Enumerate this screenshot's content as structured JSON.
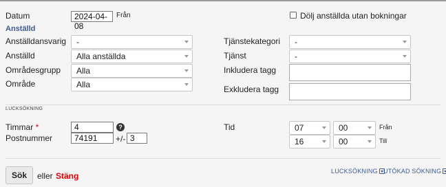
{
  "form": {
    "date_label": "Datum",
    "date_value": "2024-04-08",
    "date_suffix": "Från",
    "hide_checkbox_label": "Dölj anställda utan bokningar",
    "hide_checkbox_checked": false,
    "section_title": "Anställd",
    "fields": {
      "responsible": {
        "label": "Anställdansvarig",
        "value": "-"
      },
      "employee": {
        "label": "Anställd",
        "value": "Alla anställda"
      },
      "area_group": {
        "label": "Områdesgrupp",
        "value": "Alla"
      },
      "area": {
        "label": "Område",
        "value": "Alla"
      },
      "service_category": {
        "label": "Tjänstekategori",
        "value": "-"
      },
      "service": {
        "label": "Tjänst",
        "value": "-"
      },
      "include_tags": {
        "label": "Inkludera tagg",
        "value": ""
      },
      "exclude_tags": {
        "label": "Exkludera tagg",
        "value": ""
      }
    }
  },
  "gap_search": {
    "section_title": "LUCKSÖKNING",
    "hours_label": "Timmar",
    "required_mark": "*",
    "hours_value": "4",
    "help_icon": "?",
    "postcode_label": "Postnummer",
    "postcode_value": "74191",
    "plus_minus_label": "+/-",
    "range_value": "3",
    "time_label": "Tid",
    "from": {
      "hour": "07",
      "minute": "00",
      "label": "Från"
    },
    "to": {
      "hour": "16",
      "minute": "00",
      "label": "Till"
    }
  },
  "footer": {
    "search_button": "Sök",
    "or_text": "eller",
    "close_link": "Stäng",
    "gap_search_toggle": "LUCKSÖKNING",
    "advanced_search_toggle": "UTÖKAD SÖKNING"
  },
  "colors": {
    "background": "#f5f5f5",
    "section_title": "#3d5a96",
    "close_link": "#e00000",
    "required": "#d0021b"
  }
}
